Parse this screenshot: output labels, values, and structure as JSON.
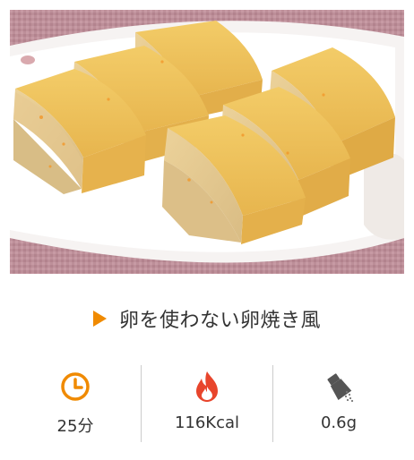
{
  "recipe": {
    "title": "卵を使わない卵焼き風",
    "photo_icon": "rolled-omelette-photo"
  },
  "stats": {
    "time": {
      "icon": "clock-icon",
      "value": "25分"
    },
    "calories": {
      "icon": "flame-icon",
      "value": "116Kcal"
    },
    "salt": {
      "icon": "salt-shaker-icon",
      "value": "0.6g"
    }
  },
  "colors": {
    "accent": "#f08a00",
    "flame": "#e8452c",
    "divider": "#cccccc",
    "text": "#333333"
  }
}
